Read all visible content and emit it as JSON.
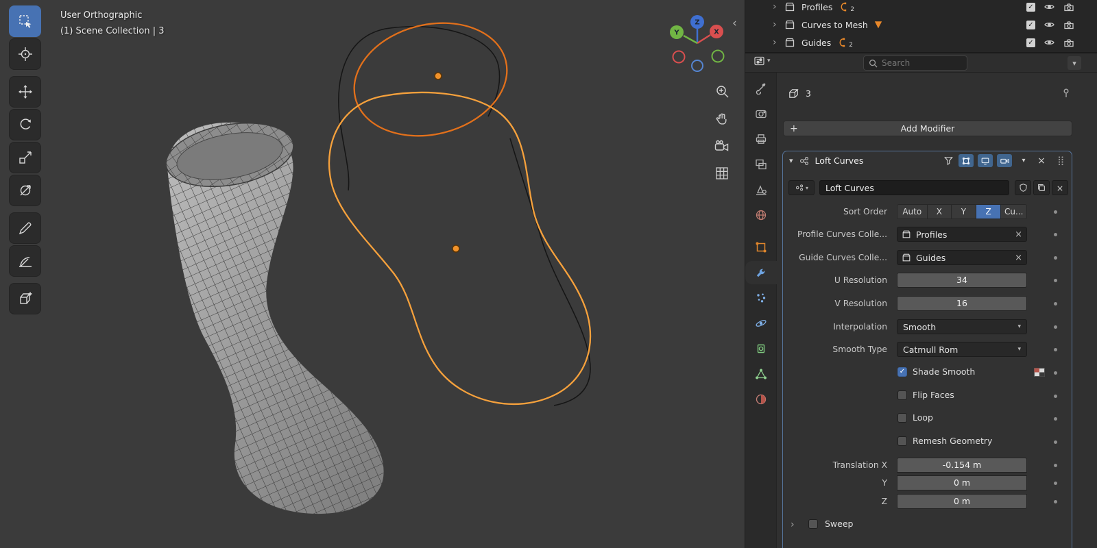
{
  "viewport": {
    "view_name": "User Orthographic",
    "collection_info": "(1) Scene Collection | 3",
    "gizmo": {
      "x": "X",
      "y": "Y",
      "z": "Z"
    },
    "toolbar_tools": [
      "select-box",
      "cursor",
      "move",
      "rotate",
      "scale",
      "transform",
      "annotate",
      "measure",
      "add-cube"
    ],
    "side_controls": [
      "zoom",
      "pan",
      "camera-view",
      "grid-toggle"
    ]
  },
  "outliner": {
    "rows": [
      {
        "label": "Profiles",
        "count": "2",
        "type_icon": "collection-box",
        "data_icon": "curve-data"
      },
      {
        "label": "Curves to Mesh",
        "count": "",
        "type_icon": "collection-box",
        "data_icon": "node-group-cone"
      },
      {
        "label": "Guides",
        "count": "2",
        "type_icon": "collection-box",
        "data_icon": "curve-data"
      }
    ]
  },
  "properties": {
    "search_placeholder": "Search",
    "object_name": "3",
    "add_modifier_label": "Add Modifier",
    "tabs": [
      "tool",
      "render",
      "output",
      "view-layer",
      "scene",
      "world",
      "object",
      "modifiers",
      "particles",
      "physics",
      "constraints",
      "object-data",
      "material"
    ],
    "active_tab": "modifiers",
    "modifier": {
      "title": "Loft Curves",
      "name_value": "Loft Curves",
      "sort_order_label": "Sort Order",
      "sort_options": [
        "Auto",
        "X",
        "Y",
        "Z",
        "Cu..."
      ],
      "sort_active": "Z",
      "profile_label": "Profile Curves Colle...",
      "profile_value": "Profiles",
      "guide_label": "Guide Curves Colle...",
      "guide_value": "Guides",
      "u_resolution_label": "U Resolution",
      "u_resolution_value": "34",
      "v_resolution_label": "V Resolution",
      "v_resolution_value": "16",
      "interpolation_label": "Interpolation",
      "interpolation_value": "Smooth",
      "smooth_type_label": "Smooth Type",
      "smooth_type_value": "Catmull Rom",
      "toggles": [
        {
          "label": "Shade Smooth",
          "checked": true
        },
        {
          "label": "Flip Faces",
          "checked": false
        },
        {
          "label": "Loop",
          "checked": false
        },
        {
          "label": "Remesh Geometry",
          "checked": false
        }
      ],
      "translation_x_label": "Translation X",
      "translation_x_value": "-0.154 m",
      "translation_y_label": "Y",
      "translation_y_value": "0 m",
      "translation_z_label": "Z",
      "translation_z_value": "0 m",
      "sweep_label": "Sweep"
    }
  },
  "glyphs": {
    "close": "×",
    "chevron_down": "▾",
    "chevron_right": "›",
    "chevron_left": "‹",
    "check": "✓",
    "plus": "+"
  },
  "colors": {
    "accent_blue": "#4772b3",
    "curve_orange_dark": "#e2701b",
    "curve_orange_light": "#f6a13c",
    "axis_x_red": "#d94f4f",
    "axis_y_green": "#71b544",
    "axis_z_blue": "#3f6fd1"
  }
}
